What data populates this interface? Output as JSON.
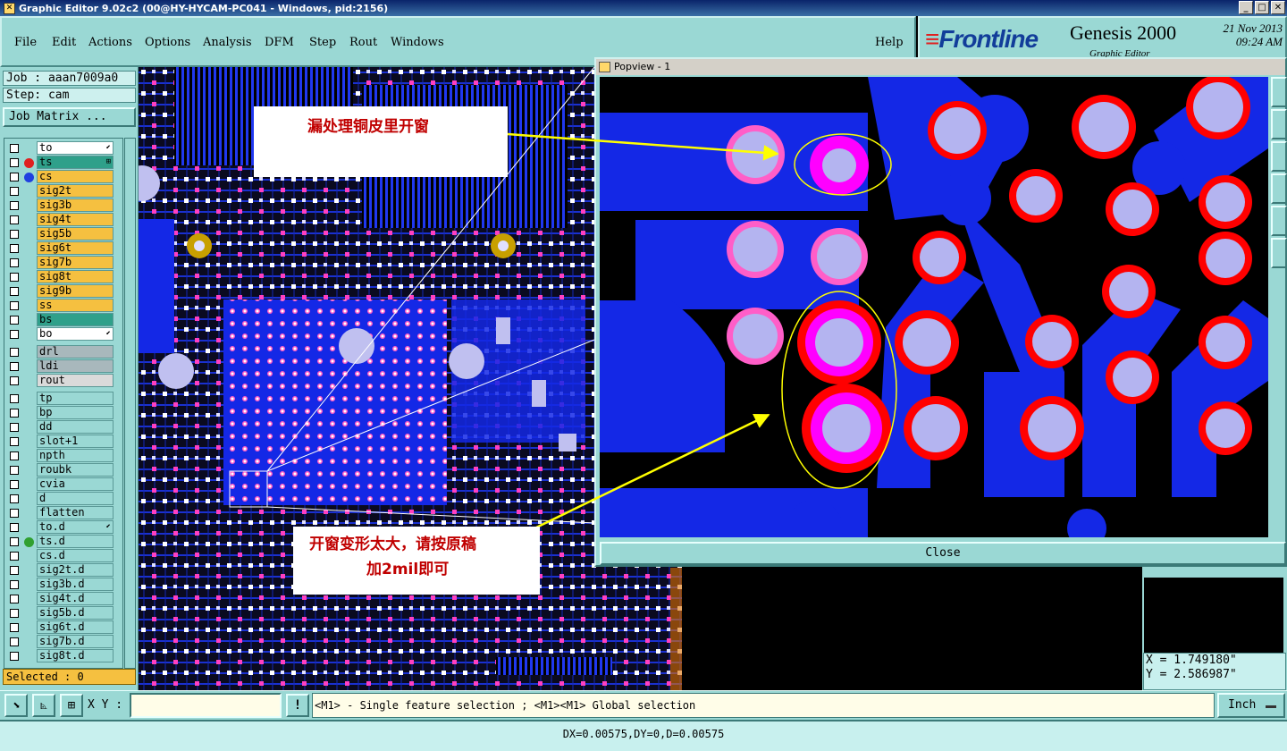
{
  "window": {
    "title": "Graphic Editor 9.02c2 (00@HY-HYCAM-PC041 - Windows, pid:2156)"
  },
  "menu": {
    "file": "File",
    "edit": "Edit",
    "actions": "Actions",
    "options": "Options",
    "analysis": "Analysis",
    "dfm": "DFM",
    "step": "Step",
    "rout": "Rout",
    "windows": "Windows",
    "help": "Help"
  },
  "logo": {
    "brand": "Frontline",
    "product": "Genesis 2000",
    "subtitle": "Graphic Editor",
    "date": "21 Nov 2013",
    "time": "09:24 AM"
  },
  "job": {
    "job_label": "Job : aaan7009a0",
    "step_label": "Step: cam",
    "matrix_button": "Job Matrix ..."
  },
  "layers": [
    {
      "name": "to",
      "color": "#ffffff",
      "mark": "⬋"
    },
    {
      "name": "ts",
      "color": "#2fa08a",
      "dot": "#e02020",
      "mark": "⊞"
    },
    {
      "name": "cs",
      "color": "#f5c040",
      "dot": "#2040e0"
    },
    {
      "name": "sig2t",
      "color": "#f5c040"
    },
    {
      "name": "sig3b",
      "color": "#f5c040"
    },
    {
      "name": "sig4t",
      "color": "#f5c040"
    },
    {
      "name": "sig5b",
      "color": "#f5c040"
    },
    {
      "name": "sig6t",
      "color": "#f5c040"
    },
    {
      "name": "sig7b",
      "color": "#f5c040"
    },
    {
      "name": "sig8t",
      "color": "#f5c040"
    },
    {
      "name": "sig9b",
      "color": "#f5c040"
    },
    {
      "name": "ss",
      "color": "#f5c040"
    },
    {
      "name": "bs",
      "color": "#2fa08a"
    },
    {
      "name": "bo",
      "color": "#ffffff",
      "mark": "⬋"
    },
    {
      "name": "drl",
      "color": "#a8b8bc"
    },
    {
      "name": "ldi",
      "color": "#a8b8bc"
    },
    {
      "name": "rout",
      "color": "#dadada"
    },
    {
      "name": "tp",
      "color": "#9ad8d4"
    },
    {
      "name": "bp",
      "color": "#9ad8d4"
    },
    {
      "name": "dd",
      "color": "#9ad8d4"
    },
    {
      "name": "slot+1",
      "color": "#9ad8d4"
    },
    {
      "name": "npth",
      "color": "#9ad8d4"
    },
    {
      "name": "roubk",
      "color": "#9ad8d4"
    },
    {
      "name": "cvia",
      "color": "#9ad8d4"
    },
    {
      "name": "d",
      "color": "#9ad8d4"
    },
    {
      "name": "flatten",
      "color": "#9ad8d4"
    },
    {
      "name": "to.d",
      "color": "#9ad8d4",
      "mark": "⬋"
    },
    {
      "name": "ts.d",
      "color": "#9ad8d4",
      "dot": "#30a030"
    },
    {
      "name": "cs.d",
      "color": "#9ad8d4"
    },
    {
      "name": "sig2t.d",
      "color": "#9ad8d4"
    },
    {
      "name": "sig3b.d",
      "color": "#9ad8d4"
    },
    {
      "name": "sig4t.d",
      "color": "#9ad8d4"
    },
    {
      "name": "sig5b.d",
      "color": "#9ad8d4"
    },
    {
      "name": "sig6t.d",
      "color": "#9ad8d4"
    },
    {
      "name": "sig7b.d",
      "color": "#9ad8d4"
    },
    {
      "name": "sig8t.d",
      "color": "#9ad8d4"
    }
  ],
  "selection": {
    "label": "Selected : 0"
  },
  "popview": {
    "title": "Popview - 1",
    "close_label": "Close"
  },
  "annotations": {
    "note1": "漏处理铜皮里开窗",
    "note2_line1": "开窗变形太大，请按原稿",
    "note2_line2": "加2mil即可"
  },
  "coords": {
    "x": "X = 1.749180\"",
    "y": "Y = 2.586987\""
  },
  "toolbar": {
    "xy_label": "X Y :",
    "xy_value": "",
    "excl": "!",
    "message": "<M1> - Single feature selection ; <M1><M1> Global selection",
    "unit": "Inch"
  },
  "status": {
    "text": "DX=0.00575,DY=0,D=0.00575"
  },
  "colors": {
    "copper": "#1428e6",
    "mask_ring": "#ff00ff",
    "pad": "#b4b4f0",
    "red_ring": "#ff0000",
    "panel": "#9ad8d4"
  }
}
